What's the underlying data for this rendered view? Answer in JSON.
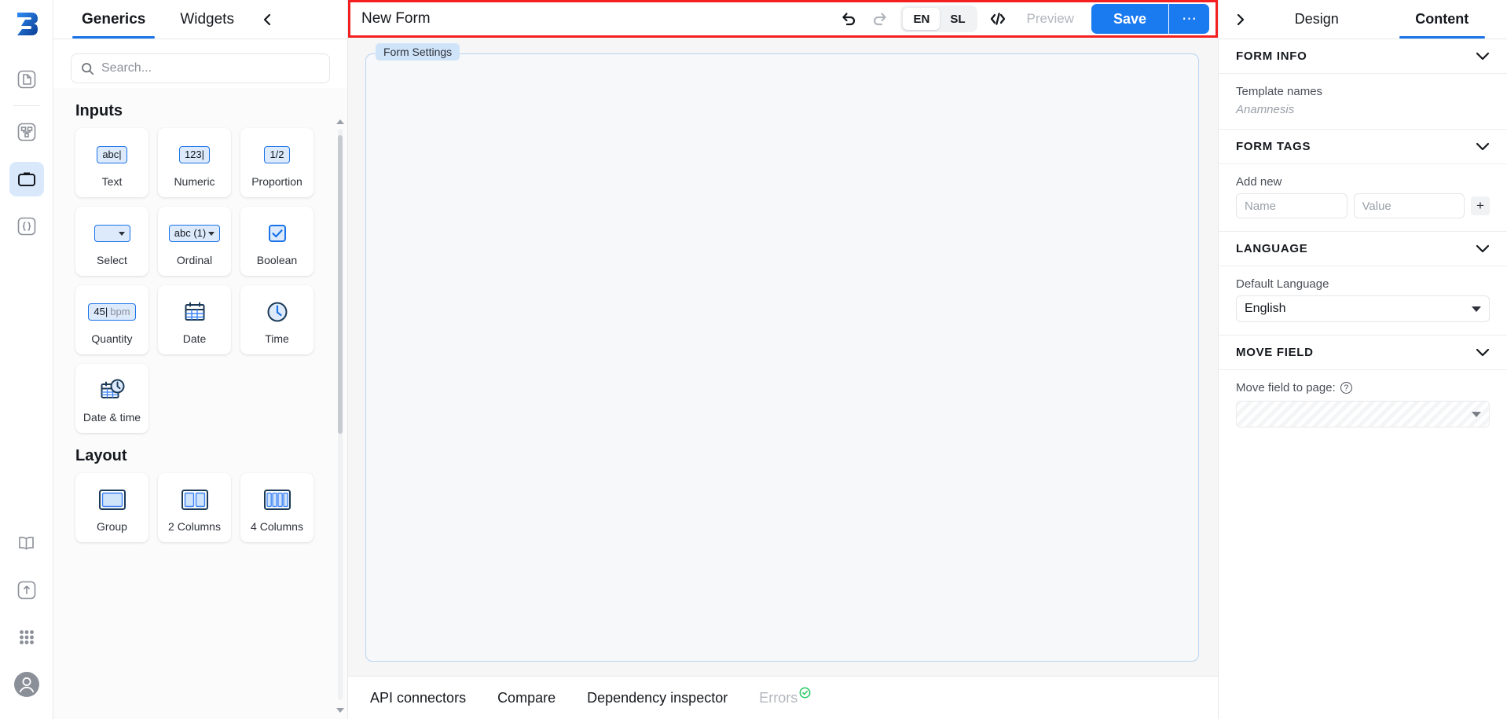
{
  "rail": {
    "logo_name": "app-logo",
    "items": [
      {
        "name": "documents-icon",
        "label": "Documents"
      },
      {
        "name": "workflow-icon",
        "label": "Workflow"
      },
      {
        "name": "forms-icon",
        "label": "Forms",
        "active": true
      },
      {
        "name": "code-braces-icon",
        "label": "Code"
      },
      {
        "name": "book-icon",
        "label": "Library"
      },
      {
        "name": "upload-icon",
        "label": "Upload"
      },
      {
        "name": "apps-grid-icon",
        "label": "Apps"
      },
      {
        "name": "user-avatar-icon",
        "label": "Account"
      }
    ]
  },
  "palette": {
    "tabs": [
      {
        "label": "Generics",
        "active": true
      },
      {
        "label": "Widgets",
        "active": false
      }
    ],
    "collapse_label": "‹",
    "search": {
      "value": "",
      "placeholder": "Search..."
    },
    "sections": [
      {
        "title": "Inputs",
        "items": [
          {
            "label": "Text",
            "icon": "text-input-icon",
            "chip": "abc|"
          },
          {
            "label": "Numeric",
            "icon": "numeric-input-icon",
            "chip": "123|"
          },
          {
            "label": "Proportion",
            "icon": "proportion-input-icon",
            "chip": "1/2"
          },
          {
            "label": "Select",
            "icon": "select-input-icon",
            "chip": ""
          },
          {
            "label": "Ordinal",
            "icon": "ordinal-input-icon",
            "chip": "abc (1)"
          },
          {
            "label": "Boolean",
            "icon": "boolean-checkbox-icon",
            "chip": ""
          },
          {
            "label": "Quantity",
            "icon": "quantity-input-icon",
            "chip": "45|",
            "chip_unit": "bpm"
          },
          {
            "label": "Date",
            "icon": "calendar-icon",
            "chip": ""
          },
          {
            "label": "Time",
            "icon": "clock-icon",
            "chip": ""
          },
          {
            "label": "Date & time",
            "icon": "calendar-clock-icon",
            "chip": ""
          }
        ]
      },
      {
        "title": "Layout",
        "items": [
          {
            "label": "Group",
            "icon": "group-layout-icon",
            "chip": ""
          },
          {
            "label": "2 Columns",
            "icon": "two-columns-icon",
            "chip": ""
          },
          {
            "label": "4 Columns",
            "icon": "four-columns-icon",
            "chip": ""
          }
        ]
      }
    ]
  },
  "toolbar": {
    "form_title": "New Form",
    "undo_label": "↶",
    "redo_label": "↷",
    "languages": [
      {
        "code": "EN",
        "active": true
      },
      {
        "code": "SL",
        "active": false
      }
    ],
    "code_label": "</>",
    "preview_label": "Preview",
    "save_label": "Save",
    "more_label": "⋯",
    "highlight_color": "#f42020"
  },
  "canvas": {
    "form_tab_label": "Form Settings"
  },
  "statusbar": {
    "links": [
      "API connectors",
      "Compare",
      "Dependency inspector"
    ],
    "errors_label": "Errors",
    "errors_ok_color": "#22c55e"
  },
  "right_panel": {
    "expand_label": "›",
    "tabs": [
      {
        "label": "Design",
        "active": false
      },
      {
        "label": "Content",
        "active": true
      }
    ],
    "sections": {
      "form_info": {
        "title": "FORM INFO",
        "template_names_label": "Template names",
        "template_name_value": "Anamnesis"
      },
      "form_tags": {
        "title": "FORM TAGS",
        "add_new_label": "Add new",
        "name_value": "",
        "name_placeholder": "Name",
        "value_value": "",
        "value_placeholder": "Value",
        "add_button_label": "+"
      },
      "language": {
        "title": "LANGUAGE",
        "default_language_label": "Default Language",
        "default_language_value": "English"
      },
      "move_field": {
        "title": "MOVE FIELD",
        "move_to_page_label": "Move field to page:",
        "help_label": "?",
        "page_value": ""
      }
    },
    "chevron_label": "ˇ"
  },
  "colors": {
    "accent": "#1a73e8",
    "save": "#1a7af0",
    "highlight": "#f42020",
    "icon_blue": "#1a73e8"
  }
}
